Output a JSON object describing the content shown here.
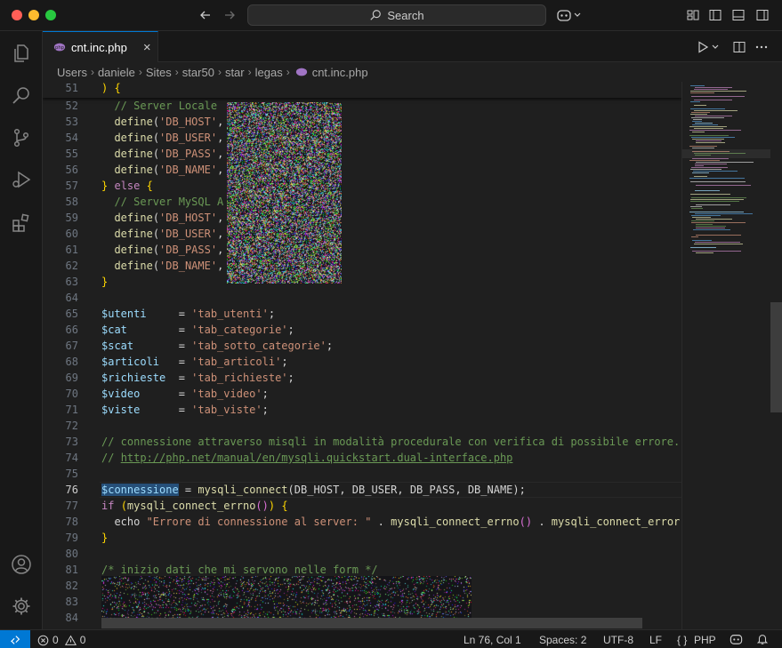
{
  "titlebar": {
    "search_label": "Search"
  },
  "tabs": [
    {
      "label": "cnt.inc.php",
      "close": "×"
    }
  ],
  "breadcrumb": [
    "Users",
    "daniele",
    "Sites",
    "star50",
    "star",
    "legas",
    "cnt.inc.php"
  ],
  "sticky": {
    "num": "51",
    "text": ") {"
  },
  "editor_lines": [
    {
      "num": "52",
      "segs": [
        [
          "c",
          "  // Server Locale"
        ]
      ]
    },
    {
      "num": "53",
      "segs": [
        [
          "d",
          "  "
        ],
        [
          "f",
          "define"
        ],
        [
          "d",
          "("
        ],
        [
          "s",
          "'DB_HOST'"
        ],
        [
          "d",
          ","
        ]
      ]
    },
    {
      "num": "54",
      "segs": [
        [
          "d",
          "  "
        ],
        [
          "f",
          "define"
        ],
        [
          "d",
          "("
        ],
        [
          "s",
          "'DB_USER'"
        ],
        [
          "d",
          ","
        ]
      ]
    },
    {
      "num": "55",
      "segs": [
        [
          "d",
          "  "
        ],
        [
          "f",
          "define"
        ],
        [
          "d",
          "("
        ],
        [
          "s",
          "'DB_PASS'"
        ],
        [
          "d",
          ","
        ]
      ]
    },
    {
      "num": "56",
      "segs": [
        [
          "d",
          "  "
        ],
        [
          "f",
          "define"
        ],
        [
          "d",
          "("
        ],
        [
          "s",
          "'DB_NAME'"
        ],
        [
          "d",
          ","
        ]
      ]
    },
    {
      "num": "57",
      "segs": [
        [
          "y",
          "}"
        ],
        [
          "d",
          " "
        ],
        [
          "k",
          "else"
        ],
        [
          "d",
          " "
        ],
        [
          "y",
          "{"
        ]
      ]
    },
    {
      "num": "58",
      "segs": [
        [
          "c",
          "  // Server MySQL A"
        ]
      ]
    },
    {
      "num": "59",
      "segs": [
        [
          "d",
          "  "
        ],
        [
          "f",
          "define"
        ],
        [
          "d",
          "("
        ],
        [
          "s",
          "'DB_HOST'"
        ],
        [
          "d",
          ","
        ]
      ]
    },
    {
      "num": "60",
      "segs": [
        [
          "d",
          "  "
        ],
        [
          "f",
          "define"
        ],
        [
          "d",
          "("
        ],
        [
          "s",
          "'DB_USER'"
        ],
        [
          "d",
          ","
        ]
      ]
    },
    {
      "num": "61",
      "segs": [
        [
          "d",
          "  "
        ],
        [
          "f",
          "define"
        ],
        [
          "d",
          "("
        ],
        [
          "s",
          "'DB_PASS'"
        ],
        [
          "d",
          ","
        ]
      ]
    },
    {
      "num": "62",
      "segs": [
        [
          "d",
          "  "
        ],
        [
          "f",
          "define"
        ],
        [
          "d",
          "("
        ],
        [
          "s",
          "'DB_NAME'"
        ],
        [
          "d",
          ","
        ]
      ]
    },
    {
      "num": "63",
      "segs": [
        [
          "y",
          "}"
        ]
      ]
    },
    {
      "num": "64",
      "segs": []
    },
    {
      "num": "65",
      "segs": [
        [
          "v",
          "$utenti"
        ],
        [
          "d",
          "     = "
        ],
        [
          "s",
          "'tab_utenti'"
        ],
        [
          "d",
          ";"
        ]
      ]
    },
    {
      "num": "66",
      "segs": [
        [
          "v",
          "$cat"
        ],
        [
          "d",
          "        = "
        ],
        [
          "s",
          "'tab_categorie'"
        ],
        [
          "d",
          ";"
        ]
      ]
    },
    {
      "num": "67",
      "segs": [
        [
          "v",
          "$scat"
        ],
        [
          "d",
          "       = "
        ],
        [
          "s",
          "'tab_sotto_categorie'"
        ],
        [
          "d",
          ";"
        ]
      ]
    },
    {
      "num": "68",
      "segs": [
        [
          "v",
          "$articoli"
        ],
        [
          "d",
          "   = "
        ],
        [
          "s",
          "'tab_articoli'"
        ],
        [
          "d",
          ";"
        ]
      ]
    },
    {
      "num": "69",
      "segs": [
        [
          "v",
          "$richieste"
        ],
        [
          "d",
          "  = "
        ],
        [
          "s",
          "'tab_richieste'"
        ],
        [
          "d",
          ";"
        ]
      ]
    },
    {
      "num": "70",
      "segs": [
        [
          "v",
          "$video"
        ],
        [
          "d",
          "      = "
        ],
        [
          "s",
          "'tab_video'"
        ],
        [
          "d",
          ";"
        ]
      ]
    },
    {
      "num": "71",
      "segs": [
        [
          "v",
          "$viste"
        ],
        [
          "d",
          "      = "
        ],
        [
          "s",
          "'tab_viste'"
        ],
        [
          "d",
          ";"
        ]
      ]
    },
    {
      "num": "72",
      "segs": []
    },
    {
      "num": "73",
      "segs": [
        [
          "c",
          "// connessione attraverso misqli in modalità procedurale con verifica di possibile errore."
        ]
      ]
    },
    {
      "num": "74",
      "segs": [
        [
          "c",
          "// "
        ],
        [
          "lnk",
          "http://php.net/manual/en/mysqli.quickstart.dual-interface.php"
        ]
      ]
    },
    {
      "num": "75",
      "segs": []
    },
    {
      "num": "76",
      "current": true,
      "segs": [
        [
          "v sel",
          "$connessione"
        ],
        [
          "d",
          " = "
        ],
        [
          "f",
          "mysqli_connect"
        ],
        [
          "d",
          "(DB_HOST, DB_USER, DB_PASS, DB_NAME);"
        ]
      ]
    },
    {
      "num": "77",
      "segs": [
        [
          "k",
          "if"
        ],
        [
          "d",
          " "
        ],
        [
          "y",
          "("
        ],
        [
          "f",
          "mysqli_connect_errno"
        ],
        [
          "p",
          "()"
        ],
        [
          "y",
          ")"
        ],
        [
          "d",
          " "
        ],
        [
          "y",
          "{"
        ]
      ]
    },
    {
      "num": "78",
      "segs": [
        [
          "d",
          "  echo "
        ],
        [
          "s",
          "\"Errore di connessione al server: \""
        ],
        [
          "d",
          " . "
        ],
        [
          "f",
          "mysqli_connect_errno"
        ],
        [
          "p",
          "()"
        ],
        [
          "d",
          " . "
        ],
        [
          "f",
          "mysqli_connect_error"
        ]
      ]
    },
    {
      "num": "79",
      "segs": [
        [
          "y",
          "}"
        ]
      ]
    },
    {
      "num": "80",
      "segs": []
    },
    {
      "num": "81",
      "segs": [
        [
          "c",
          "/* inizio dati che mi servono nelle form */"
        ]
      ]
    },
    {
      "num": "82",
      "segs": []
    },
    {
      "num": "83",
      "segs": []
    },
    {
      "num": "84",
      "segs": []
    },
    {
      "num": "85",
      "segs": []
    }
  ],
  "statusbar": {
    "errors": "0",
    "warnings": "0",
    "position": "Ln 76, Col 1",
    "spaces": "Spaces: 2",
    "encoding": "UTF-8",
    "eol": "LF",
    "language_icon": "{ }",
    "language": "PHP"
  },
  "icons": [
    "files-icon",
    "search-icon",
    "source-control-icon",
    "run-debug-icon",
    "extensions-icon",
    "account-icon",
    "gear-icon",
    "copilot-icon",
    "bell-icon",
    "remote-icon",
    "php-file-icon"
  ],
  "colors": {
    "accent": "#0078d4",
    "background": "#1f1f1f",
    "chrome": "#181818"
  }
}
